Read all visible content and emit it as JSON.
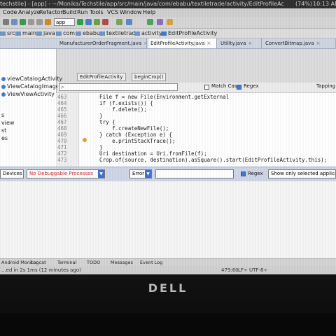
{
  "window": {
    "title": "techstile] - [app] - ~/Monika/Techstile/app/src/main/java/com/ebabu/textiletrade/activity/EditProfileAc",
    "battery": "(74%)",
    "clock": "10:13 AM"
  },
  "menu": [
    "Code",
    "Analyze",
    "Refactor",
    "Build",
    "Run",
    "Tools",
    "VCS",
    "Window",
    "Help"
  ],
  "toolbar": {
    "run_config": "app"
  },
  "breadcrumbs": [
    "src",
    "main",
    "java",
    "com",
    "ebabu",
    "textiletrade",
    "activity",
    "EditProfileActivity"
  ],
  "editor_tabs": [
    {
      "label": "ManufacturerOrderFragment.java",
      "active": false
    },
    {
      "label": "EditProfileActivity.java",
      "active": true
    },
    {
      "label": "Utility.java",
      "active": false
    },
    {
      "label": "ConvertBitmap.java",
      "active": false
    }
  ],
  "sidebar": {
    "items": [
      "viewCatalogActivity",
      "ViewCatalogImagesActivity",
      "ViewViewActivity",
      "s",
      "view",
      "st",
      "es"
    ]
  },
  "subtabs": [
    "EditProfileActivity",
    "beginCrop()"
  ],
  "search": {
    "match_case": "Match Case",
    "match_case_checked": false,
    "regex": "Regex",
    "regex_checked": true,
    "trailing": "Tapping"
  },
  "editor": {
    "line_numbers": [
      "463",
      "464",
      "465",
      "466",
      "467",
      "468",
      "469",
      "470",
      "471",
      "472",
      "473"
    ],
    "lines": [
      "    File f = new File(Environment.getExternal",
      "    if (f.exists()) {",
      "        f.delete();",
      "    }",
      "    try {",
      "        f.createNewFile();",
      "    } catch (Exception e) {",
      "        e.printStackTrace();",
      "    }",
      "    Uri destination = Uri.fromFile(f);",
      "    Crop.of(source, destination).asSquare().start(EditProfileActivity.this);"
    ]
  },
  "logcat": {
    "device": "Devices",
    "process": "No Debuggable Processes",
    "level": "Error",
    "regex_label": "Regex",
    "regex_checked": true,
    "filter": "Show only selected application"
  },
  "tool_tabs": [
    "Android Monitor",
    "Logcat",
    "Terminal",
    "TODO",
    "Messages",
    "Event Log"
  ],
  "status": {
    "message": "...ed in 2s 1ms (12 minutes ago)",
    "position": "479:60",
    "encoding": "LF÷ UTF-8÷"
  },
  "bezel": {
    "logo": "DELL"
  },
  "colors": {
    "accent": "#3a6fd8",
    "process_text": "#d0202a",
    "tab_active": "#ffffff"
  }
}
